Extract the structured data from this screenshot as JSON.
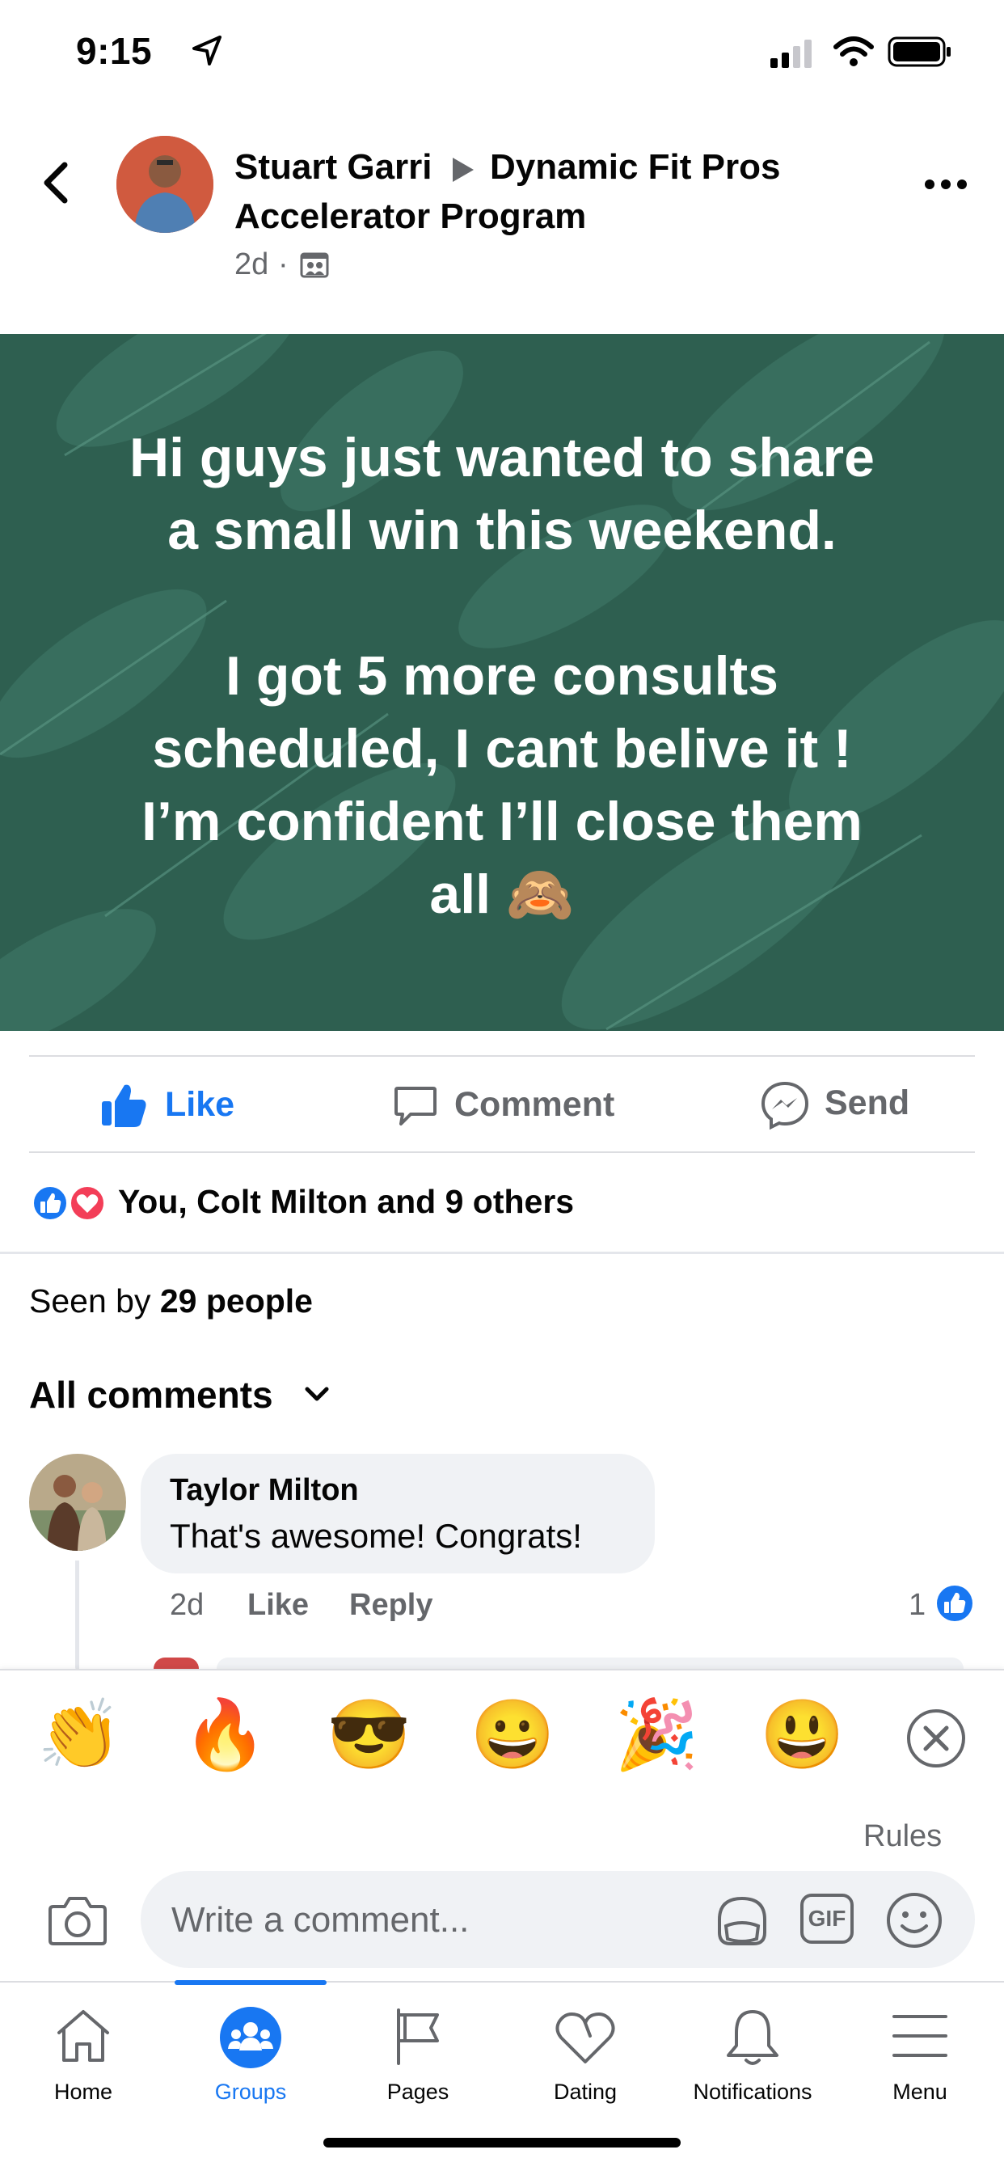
{
  "status_bar": {
    "time": "9:15"
  },
  "header": {
    "author": "Stuart Garri",
    "group": "Dynamic Fit Pros",
    "group_line2": "Accelerator Program",
    "time": "2d",
    "separator": "·"
  },
  "post": {
    "text": "Hi guys just wanted to share\na small win this weekend.\n\nI got 5 more consults\nscheduled, I cant belive it !\nI’m confident I’ll close them\nall 🙈",
    "background_color": "#2e5f50"
  },
  "actions": {
    "like": "Like",
    "comment": "Comment",
    "send": "Send"
  },
  "reactions": {
    "summary": "You, Colt Milton and 9 others"
  },
  "seen": {
    "prefix": "Seen by",
    "count": "29 people"
  },
  "comments": {
    "filter_label": "All comments",
    "items": [
      {
        "author": "Taylor Milton",
        "text": "That's awesome! Congrats!",
        "time": "2d",
        "like": "Like",
        "reply": "Reply",
        "reaction_count": "1"
      }
    ]
  },
  "quick_emojis": [
    "👏",
    "🔥",
    "😎",
    "😀",
    "🎉",
    "😃"
  ],
  "rules_label": "Rules",
  "composer": {
    "placeholder": "Write a comment...",
    "gif": "GIF"
  },
  "tabs": [
    {
      "label": "Home",
      "icon": "home-icon"
    },
    {
      "label": "Groups",
      "icon": "groups-icon",
      "active": true
    },
    {
      "label": "Pages",
      "icon": "flag-icon"
    },
    {
      "label": "Dating",
      "icon": "heart-icon"
    },
    {
      "label": "Notifications",
      "icon": "bell-icon"
    },
    {
      "label": "Menu",
      "icon": "menu-icon"
    }
  ],
  "colors": {
    "accent": "#1877f2",
    "heart": "#f33e58",
    "muted": "#65676b"
  }
}
